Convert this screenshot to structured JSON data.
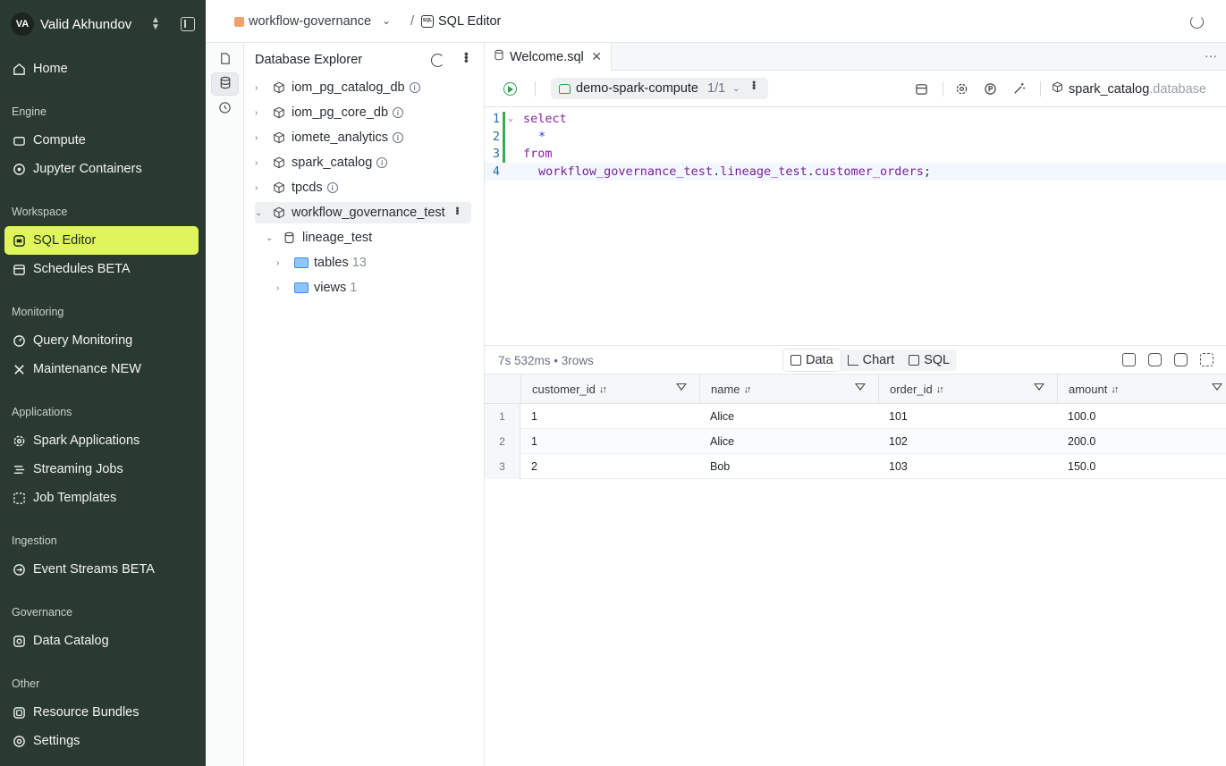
{
  "user": {
    "initials": "VA",
    "name": "Valid Akhundov"
  },
  "nav": {
    "home": "Home",
    "sections": {
      "engine": "Engine",
      "workspace": "Workspace",
      "monitoring": "Monitoring",
      "applications": "Applications",
      "ingestion": "Ingestion",
      "governance": "Governance",
      "other": "Other"
    },
    "compute": "Compute",
    "jupyter": "Jupyter Containers",
    "sql_editor": "SQL Editor",
    "schedules": "Schedules BETA",
    "query_monitoring": "Query Monitoring",
    "maintenance": "Maintenance NEW",
    "spark_apps": "Spark Applications",
    "streaming_jobs": "Streaming Jobs",
    "job_templates": "Job Templates",
    "event_streams": "Event Streams BETA",
    "data_catalog": "Data Catalog",
    "resource_bundles": "Resource Bundles",
    "settings": "Settings"
  },
  "topbar": {
    "project": "workflow-governance",
    "slash": "/",
    "page": "SQL Editor",
    "sql_icon_text": "SQL"
  },
  "explorer": {
    "title": "Database Explorer",
    "items": [
      "iom_pg_catalog_db",
      "iom_pg_core_db",
      "iomete_analytics",
      "spark_catalog",
      "tpcds",
      "workflow_governance_test"
    ],
    "schema": "lineage_test",
    "folders": [
      {
        "label": "tables",
        "count": "13"
      },
      {
        "label": "views",
        "count": "1"
      }
    ]
  },
  "editor": {
    "tab": "Welcome.sql",
    "compute": "demo-spark-compute",
    "compute_fraction": "1/1",
    "catalog": "spark_catalog",
    "database_placeholder": ".database",
    "lines": {
      "n1": "1",
      "n2": "2",
      "n3": "3",
      "n4": "4",
      "l1": "select",
      "l2": "*",
      "l3": "from",
      "l4_a": "workflow_governance_test",
      "l4_b": ".",
      "l4_c": "lineage_test",
      "l4_d": ".",
      "l4_e": "customer_orders",
      "l4_f": ";"
    }
  },
  "results": {
    "stats": "7s 532ms  •  3rows",
    "tabs": {
      "data": "Data",
      "chart": "Chart",
      "sql": "SQL"
    },
    "columns": [
      "customer_id",
      "name",
      "order_id",
      "amount"
    ],
    "rows": [
      [
        "1",
        "1",
        "Alice",
        "101",
        "100.0"
      ],
      [
        "2",
        "1",
        "Alice",
        "102",
        "200.0"
      ],
      [
        "3",
        "2",
        "Bob",
        "103",
        "150.0"
      ]
    ]
  }
}
